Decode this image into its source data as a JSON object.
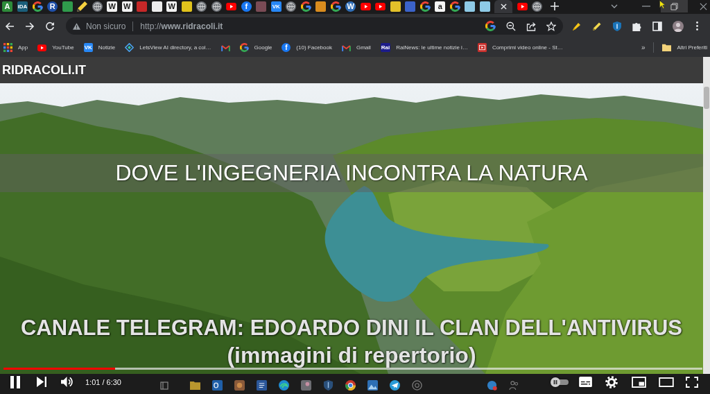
{
  "browser": {
    "tabs": [
      {
        "kind": "letter",
        "color": "#2e8b3a",
        "glyph": "A",
        "selected": false
      },
      {
        "kind": "letter",
        "color": "#1b5e7a",
        "glyph": "iDA",
        "selected": false
      },
      {
        "kind": "google",
        "selected": false
      },
      {
        "kind": "round",
        "color": "#1f4fa8",
        "glyph": "R",
        "selected": false
      },
      {
        "kind": "plain",
        "color": "#2f9a4c",
        "selected": false
      },
      {
        "kind": "pencil",
        "selected": false
      },
      {
        "kind": "globe",
        "selected": false
      },
      {
        "kind": "letter",
        "color": "#f2f2f2",
        "glyph": "W",
        "selected": false
      },
      {
        "kind": "letter",
        "color": "#f2f2f2",
        "glyph": "W",
        "selected": false
      },
      {
        "kind": "plain",
        "color": "#c62828",
        "selected": false
      },
      {
        "kind": "plain",
        "color": "#ededed",
        "selected": false
      },
      {
        "kind": "letter",
        "color": "#f2f2f2",
        "glyph": "W",
        "selected": false
      },
      {
        "kind": "plain",
        "color": "#e0c21c",
        "selected": false
      },
      {
        "kind": "globe",
        "selected": false
      },
      {
        "kind": "globe",
        "selected": false
      },
      {
        "kind": "youtube",
        "selected": false
      },
      {
        "kind": "round",
        "color": "#1877f2",
        "glyph": "f",
        "selected": false
      },
      {
        "kind": "plain",
        "color": "#7a4b55",
        "selected": false
      },
      {
        "kind": "letter",
        "color": "#2787f5",
        "glyph": "VK",
        "selected": false
      },
      {
        "kind": "globe",
        "selected": false
      },
      {
        "kind": "google",
        "selected": false
      },
      {
        "kind": "plain",
        "color": "#d98c1e",
        "selected": false
      },
      {
        "kind": "google",
        "selected": false
      },
      {
        "kind": "round",
        "color": "#2f6db5",
        "glyph": "W",
        "selected": false
      },
      {
        "kind": "youtube",
        "selected": false
      },
      {
        "kind": "youtube",
        "selected": false
      },
      {
        "kind": "plain",
        "color": "#e2c02a",
        "selected": false
      },
      {
        "kind": "plain",
        "color": "#3b63c9",
        "selected": false
      },
      {
        "kind": "google",
        "selected": false
      },
      {
        "kind": "letter",
        "color": "#f5f5f5",
        "glyph": "a",
        "selected": false
      },
      {
        "kind": "google",
        "selected": false
      },
      {
        "kind": "plain",
        "color": "#8ecae6",
        "selected": false
      },
      {
        "kind": "plain",
        "color": "#8ecae6",
        "selected": false
      },
      {
        "selected": true
      },
      {
        "kind": "youtube",
        "selected": false
      },
      {
        "kind": "globe",
        "selected": false
      }
    ],
    "address_bar": {
      "security": "Non sicuro",
      "url": "http://**www.ridracoli.it**"
    },
    "bookmarks": [
      {
        "kind": "apps",
        "label": "App"
      },
      {
        "kind": "youtube",
        "label": "YouTube"
      },
      {
        "kind": "letter",
        "color": "#2787f5",
        "glyph": "VK",
        "label": "Notizie"
      },
      {
        "kind": "diamond",
        "label": "LetsView AI directory, a col…"
      },
      {
        "kind": "mail"
      },
      {
        "kind": "google",
        "label": "Google"
      },
      {
        "kind": "round",
        "color": "#1877f2",
        "glyph": "f",
        "label": "(10) Facebook"
      },
      {
        "kind": "mail",
        "label": "Gmail"
      },
      {
        "kind": "letter",
        "color": "#1c1c8a",
        "glyph": "Rai",
        "label": "RaiNews: le ultime notizie i…"
      },
      {
        "kind": "video",
        "label": "Comprimi video online - St…"
      }
    ],
    "bookmarks_overflow": "»",
    "other_bookmarks": "Altri Preferiti"
  },
  "page": {
    "title": "RIDRACOLI.IT",
    "banner": "DOVE L'INGEGNERIA INCONTRA LA NATURA"
  },
  "video": {
    "captions": [
      "CANALE TELEGRAM: EDOARDO DINI IL CLAN DELL'ANTIVIRUS",
      "(immagini di repertorio)"
    ]
  },
  "player": {
    "playing": true,
    "muted": false,
    "level": 0.16,
    "time": "1:01 / 6:30",
    "autoplay": {
      "on": false
    }
  }
}
